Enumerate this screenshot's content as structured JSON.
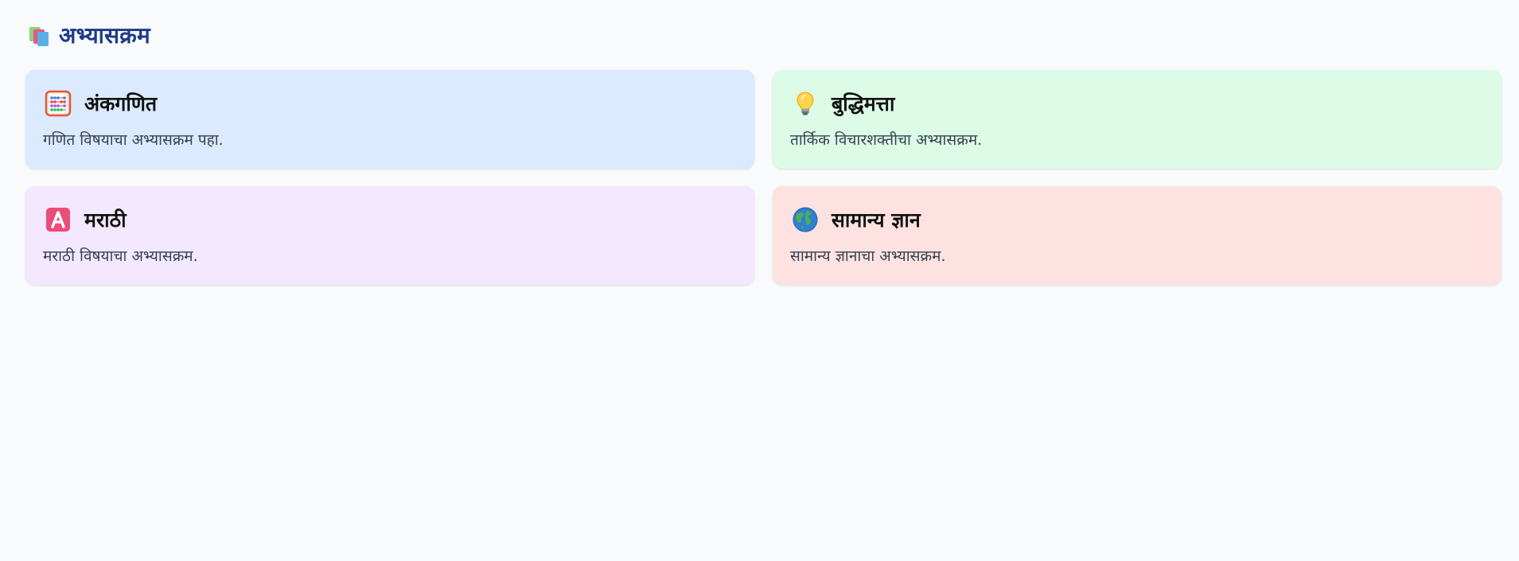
{
  "header": {
    "icon": "books-icon",
    "title": "अभ्यासक्रम"
  },
  "cards": [
    {
      "icon": "abacus-icon",
      "title": "अंकगणित",
      "description": "गणित विषयाचा अभ्यासक्रम पहा.",
      "background": "#dbeafe"
    },
    {
      "icon": "lightbulb-icon",
      "title": "बुद्धिमत्ता",
      "description": "तार्किक विचारशक्तीचा अभ्यासक्रम.",
      "background": "#dcfce7"
    },
    {
      "icon": "letter-a-icon",
      "title": "मराठी",
      "description": "मराठी विषयाचा अभ्यासक्रम.",
      "background": "#f3e8ff"
    },
    {
      "icon": "globe-icon",
      "title": "सामान्य ज्ञान",
      "description": "सामान्य ज्ञानाचा अभ्यासक्रम.",
      "background": "#fee2e2"
    }
  ],
  "colors": {
    "page_background": "#f8fafc",
    "title": "#1e3a8a",
    "card_title": "#111111",
    "card_description": "#374151"
  }
}
